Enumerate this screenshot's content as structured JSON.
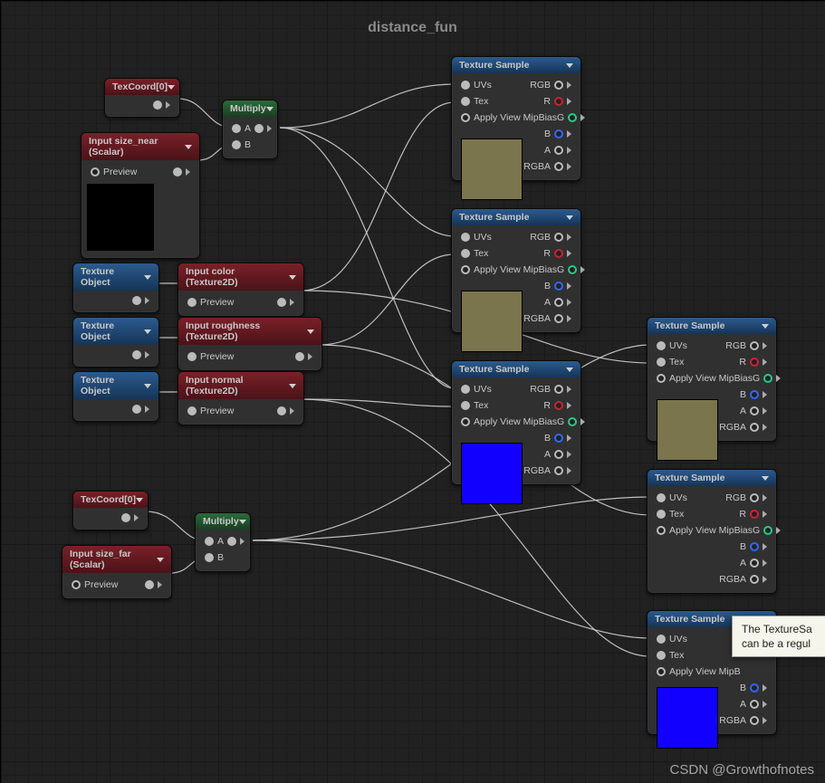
{
  "title": "distance_fun",
  "nodes": {
    "texcoord1": {
      "title": "TexCoord[0]"
    },
    "texcoord2": {
      "title": "TexCoord[0]"
    },
    "size_near": {
      "title": "Input size_near (Scalar)",
      "preview": "Preview"
    },
    "size_far": {
      "title": "Input size_far (Scalar)",
      "preview": "Preview"
    },
    "multiply1": {
      "title": "Multiply",
      "a": "A",
      "b": "B"
    },
    "multiply2": {
      "title": "Multiply",
      "a": "A",
      "b": "B"
    },
    "texobj1": {
      "title": "Texture Object"
    },
    "texobj2": {
      "title": "Texture Object"
    },
    "texobj3": {
      "title": "Texture Object"
    },
    "in_color": {
      "title": "Input color (Texture2D)",
      "preview": "Preview"
    },
    "in_rough": {
      "title": "Input roughness (Texture2D)",
      "preview": "Preview"
    },
    "in_normal": {
      "title": "Input normal (Texture2D)",
      "preview": "Preview"
    },
    "tsample": {
      "title": "Texture Sample",
      "in": {
        "uvs": "UVs",
        "tex": "Tex",
        "mip": "Apply View MipBias"
      },
      "out": {
        "rgb": "RGB",
        "r": "R",
        "g": "G",
        "b": "B",
        "a": "A",
        "rgba": "RGBA"
      }
    }
  },
  "tooltip": {
    "line1": "The TextureSa",
    "line2": "can be a regul"
  },
  "watermark": "CSDN @Growthofnotes"
}
